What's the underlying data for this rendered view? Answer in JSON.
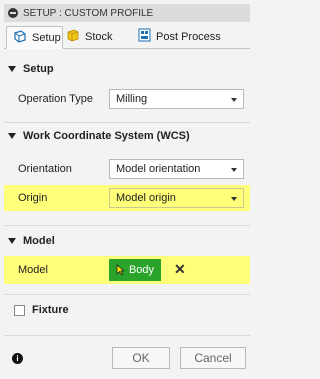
{
  "window": {
    "title": "SETUP : CUSTOM PROFILE"
  },
  "tabs": [
    {
      "label": "Setup",
      "icon": "setup-icon"
    },
    {
      "label": "Stock",
      "icon": "stock-cube-icon"
    },
    {
      "label": "Post Process",
      "icon": "post-process-icon"
    }
  ],
  "sections": {
    "setup": {
      "header": "Setup",
      "operation_type": {
        "label": "Operation Type",
        "value": "Milling"
      }
    },
    "wcs": {
      "header": "Work Coordinate System (WCS)",
      "orientation": {
        "label": "Orientation",
        "value": "Model orientation"
      },
      "origin": {
        "label": "Origin",
        "value": "Model origin"
      }
    },
    "model": {
      "header": "Model",
      "model_row": {
        "label": "Model",
        "button": "Body",
        "clear": "✕"
      }
    },
    "fixture": {
      "label": "Fixture"
    }
  },
  "footer": {
    "ok": "OK",
    "cancel": "Cancel",
    "info": "i"
  },
  "colors": {
    "highlight": "#ffff7a",
    "body_button": "#29a329"
  }
}
